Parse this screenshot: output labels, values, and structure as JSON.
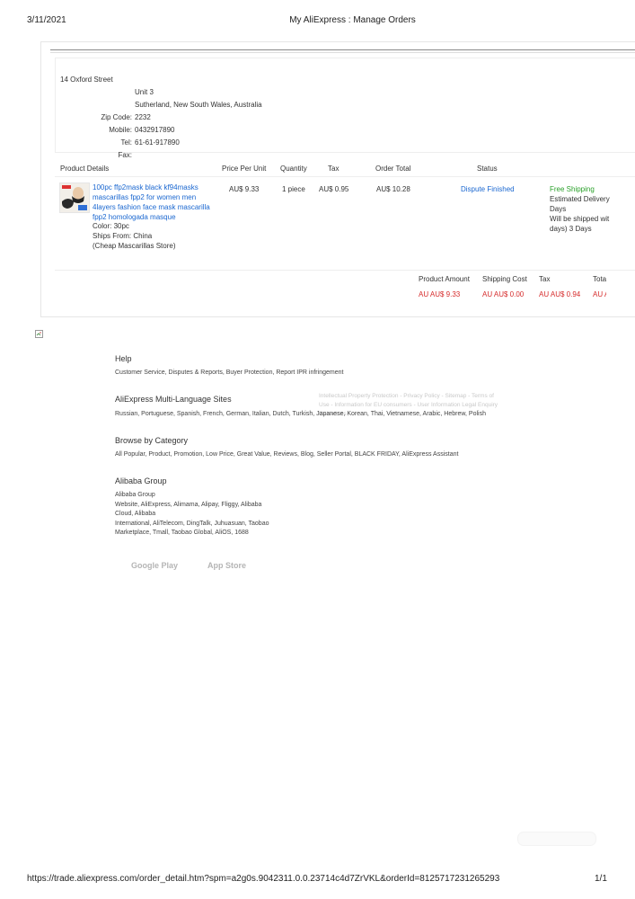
{
  "print_header": {
    "date": "3/11/2021",
    "title": "My AliExpress : Manage Orders"
  },
  "address": {
    "street": "14 Oxford Street",
    "line2": "Unit 3",
    "line3": "Sutherland, New South Wales, Australia",
    "zip_label": "Zip Code:",
    "zip": "2232",
    "mobile_label": "Mobile:",
    "mobile": "0432917890",
    "tel_label": "Tel:",
    "tel": "61-61-917890",
    "fax_label": "Fax:"
  },
  "table": {
    "headers": {
      "product_details": "Product Details",
      "price_per_unit": "Price Per Unit",
      "quantity": "Quantity",
      "tax": "Tax",
      "order_total": "Order Total",
      "status": "Status"
    },
    "item": {
      "title_lines": [
        "100pc ffp2mask black kf94masks",
        "mascarillas fpp2 for women men",
        "4layers fashion face mask mascarilla",
        "fpp2 homologada masque"
      ],
      "color": "Color: 30pc",
      "ships_from": "Ships From: China",
      "store": "(Cheap Mascarillas Store)",
      "price": "AU$ 9.33",
      "quantity": "1 piece",
      "tax": "AU$ 0.95",
      "order_total": "AU$ 10.28",
      "status": "Dispute Finished",
      "shipping": "Free Shipping",
      "delivery_lines": [
        "Estimated Delivery",
        "Days",
        "Will be shipped wit",
        "days) 3 Days"
      ]
    }
  },
  "summary": {
    "product_amount_label": "Product Amount",
    "shipping_cost_label": "Shipping Cost",
    "tax_label": "Tax",
    "total_label": "Tota",
    "product_amount": "AU AU$ 9.33",
    "shipping_cost": "AU AU$ 0.00",
    "tax": "AU AU$ 0.94",
    "total": "AU A"
  },
  "footer": {
    "help_title": "Help",
    "help_links": "Customer Service, Disputes & Reports, Buyer Protection, Report IPR infringement",
    "lang_title": "AliExpress Multi-Language Sites",
    "lang_links": "Russian, Portuguese, Spanish, French, German, Italian, Dutch, Turkish, Japanese, Korean, Thai, Vietnamese, Arabic, Hebrew, Polish",
    "ghost_lines": [
      "Intellectual Property Protection - Privacy Policy - Sitemap - Terms of",
      "Use - Information for EU consumers - User Information Legal Enquiry",
      "Guidelines"
    ],
    "browse_title": "Browse by Category",
    "browse_links": "All Popular, Product, Promotion, Low Price, Great Value, Reviews, Blog, Seller Portal, BLACK FRIDAY, AliExpress Assistant",
    "alibaba_title": "Alibaba Group",
    "alibaba_lines": [
      "Alibaba Group",
      "Website, AliExpress, Alimama, Alipay, Fliggy, Alibaba",
      "Cloud, Alibaba",
      "International, AliTelecom, DingTalk, Juhuasuan, Taobao",
      "Marketplace, Tmall, Taobao Global, AliOS, 1688"
    ],
    "google_play": "Google Play",
    "app_store": "App Store"
  },
  "print_footer": {
    "url": "https://trade.aliexpress.com/order_detail.htm?spm=a2g0s.9042311.0.0.23714c4d7ZrVKL&orderId=8125717231265293",
    "page": "1/1"
  },
  "colors": {
    "link": "#1a67d0",
    "green": "#2aa02a",
    "red": "#d62b2b"
  },
  "icons": {
    "broken_image": "broken-image-icon"
  }
}
